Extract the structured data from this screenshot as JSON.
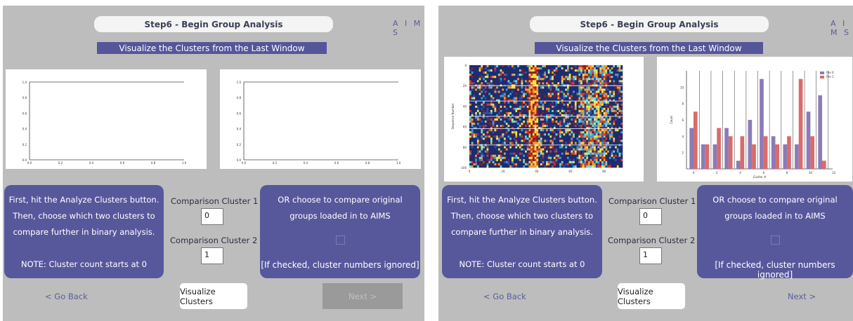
{
  "screens": [
    {
      "title": "Step6 - Begin Group Analysis",
      "brand": "A I M S",
      "subtitle": "Visualize the Clusters from the Last Window",
      "instructions": {
        "line1": "First, hit the Analyze Clusters button.",
        "line2": "Then, choose which two clusters to",
        "line3": "compare further in binary analysis.",
        "note": "NOTE: Cluster count starts at 0"
      },
      "comparison1": {
        "label": "Comparison Cluster 1",
        "value": "0"
      },
      "comparison2": {
        "label": "Comparison Cluster 2",
        "value": "1"
      },
      "original_groups": {
        "line1": "OR choose to compare original",
        "line2": "groups loaded in to AIMS",
        "checked": false,
        "note": "[If checked, cluster numbers ignored]"
      },
      "buttons": {
        "back": "< Go Back",
        "visualize": "Visualize Clusters",
        "next": "Next >",
        "next_enabled": false
      },
      "plots": {
        "empty_y_ticks": [
          "1.0",
          "0.8",
          "0.6",
          "0.4",
          "0.2",
          "0.0"
        ],
        "empty_x_ticks": [
          "0.2",
          "0.4",
          "0.6",
          "0.8",
          "1.0"
        ],
        "empty_x_first": "0.0"
      }
    },
    {
      "title": "Step6 - Begin Group Analysis",
      "brand": "A I M S",
      "subtitle": "Visualize the Clusters from the Last Window",
      "instructions": {
        "line1": "First, hit the Analyze Clusters button.",
        "line2": "Then, choose which two clusters to",
        "line3": "compare further in binary analysis.",
        "note": "NOTE: Cluster count starts at 0"
      },
      "comparison1": {
        "label": "Comparison Cluster 1",
        "value": "0"
      },
      "comparison2": {
        "label": "Comparison Cluster 2",
        "value": "1"
      },
      "original_groups": {
        "line1": "OR choose to compare original",
        "line2": "groups loaded in to AIMS",
        "checked": false,
        "note": "[If checked, cluster numbers ignored]"
      },
      "buttons": {
        "back": "< Go Back",
        "visualize": "Visualize Clusters",
        "next": "Next >",
        "next_enabled": true
      }
    }
  ],
  "heatmap": {
    "y_ticks": [
      "0",
      "20",
      "40",
      "60",
      "80",
      "100"
    ],
    "x_ticks": [
      "0",
      "20",
      "40",
      "60",
      "80"
    ],
    "ylabel": "Sequence Number",
    "palette": [
      "#1f2b6e",
      "#2f4fa3",
      "#39a0d1",
      "#7ed3c4",
      "#f4e34b",
      "#f29d2b",
      "#d73a27",
      "#8e1b1b"
    ]
  },
  "chart_data": {
    "type": "bar",
    "xlabel": "Cluster #",
    "ylabel": "Count",
    "ylim": [
      0,
      12
    ],
    "x_ticks": [
      "0",
      "2",
      "4",
      "6",
      "8",
      "10",
      "12"
    ],
    "y_ticks": [
      "2",
      "4",
      "6",
      "8",
      "10"
    ],
    "categories": [
      "0",
      "1",
      "2",
      "3",
      "4",
      "5",
      "6",
      "7",
      "8",
      "9",
      "10",
      "11"
    ],
    "series": [
      {
        "name": "File 0",
        "color": "#8c7bb8",
        "values": [
          5,
          3,
          3,
          5,
          1,
          6,
          11,
          4,
          3,
          3,
          7,
          9
        ]
      },
      {
        "name": "File 1",
        "color": "#d96b6b",
        "values": [
          7,
          3,
          5,
          4,
          4,
          3,
          4,
          3,
          4,
          11,
          4,
          1
        ]
      }
    ],
    "legend_position": "top-right"
  }
}
